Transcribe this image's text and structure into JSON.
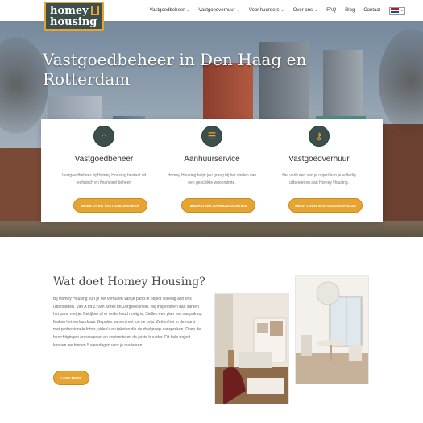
{
  "brand": {
    "line1": "homey",
    "line2": "housing"
  },
  "nav": {
    "items": [
      {
        "label": "Vastgoedbeheer",
        "has_dropdown": true
      },
      {
        "label": "Vastgoedverhuur",
        "has_dropdown": true
      },
      {
        "label": "Voor huurders",
        "has_dropdown": true
      },
      {
        "label": "Over ons",
        "has_dropdown": true
      },
      {
        "label": "FAQ",
        "has_dropdown": false
      },
      {
        "label": "Blog",
        "has_dropdown": false
      },
      {
        "label": "Contact",
        "has_dropdown": false
      }
    ],
    "language": "NL"
  },
  "hero": {
    "title": "Vastgoedbeheer in Den Haag en Rotterdam"
  },
  "services": [
    {
      "icon": "house-icon",
      "title": "Vastgoedbeheer",
      "description": "Vastgoedbeheer bij Homey Housing bestaat uit technisch en financieel beheer.",
      "button": "MEER OVER VASTGOEDBEHEER"
    },
    {
      "icon": "list-icon",
      "title": "Aanhuurservice",
      "description": "Homey Housing helpt jou graag bij het vinden van een geschikte woonruimte.",
      "button": "MEER OVER AANHUURSERVICE"
    },
    {
      "icon": "key-icon",
      "title": "Vastgoedverhuur",
      "description": "Het verhuren van je object kun je volledig uitbesteden aan Homey Housing.",
      "button": "MEER OVER VASTGOEDVERHUUR"
    }
  ],
  "about": {
    "title": "Wat doet Homey Housing?",
    "text": "Bij Homey Housing kun je het verhuren van je pand of object volledig aan ons uitbesteden. Van A tot Z: van Adres tot Zorgeloosheid. Wij inspecteren dan samen het pand met je. Bekijken of er onderhoud nodig is. Stellen een plan van aanpak op. Maken het verhuurklaar. Bepalen samen met jou de prijs. Zetten het in de markt met professionele foto's, video's en teksten die de doelgroep aanspreken. Doen de bezichtigingen en screenen en contracteren de juiste huurder. Dit hele traject kunnen we binnen 5 werkdagen voor je realiseren.",
    "button": "LEES MEER"
  },
  "colors": {
    "accent": "#e6a532",
    "brand_dark": "#3d4f4c"
  }
}
